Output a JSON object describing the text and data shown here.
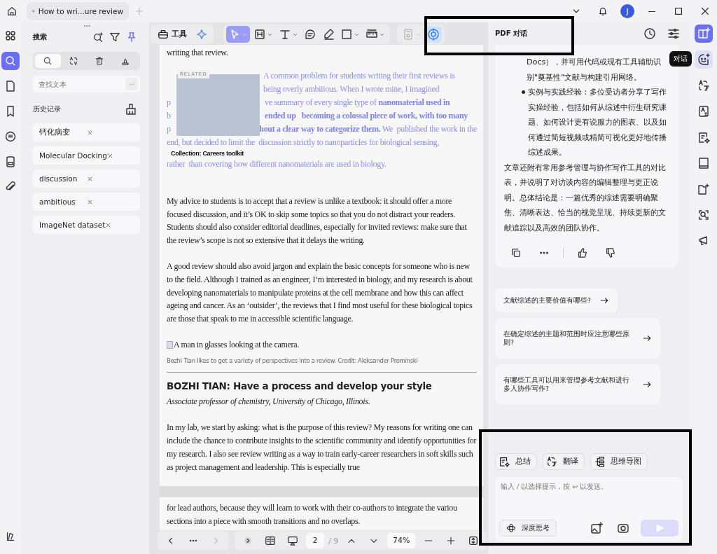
{
  "tab_bar": {
    "tab": "How to wri...ure review",
    "avatar": "J"
  },
  "left_rail": {
    "items": [
      {
        "kind": "apps",
        "selected": false
      },
      {
        "kind": "search",
        "selected": true
      },
      {
        "kind": "page",
        "selected": false
      },
      {
        "kind": "bookmark",
        "selected": false
      },
      {
        "kind": "comment",
        "selected": false
      },
      {
        "kind": "form",
        "selected": false
      },
      {
        "kind": "attachment",
        "selected": false
      }
    ]
  },
  "search_panel": {
    "title": "搜索",
    "modes": [
      {
        "kind": "search",
        "selected": true
      },
      {
        "kind": "replace",
        "selected": false
      },
      {
        "kind": "delete",
        "selected": false
      },
      {
        "kind": "stamp",
        "selected": false
      }
    ],
    "search": {
      "placeholder": "查找文本"
    },
    "history_title": "历史记录",
    "history": [
      "钙化病变",
      "Molecular Docking",
      "discussion",
      "ambitious",
      "ImageNet dataset"
    ]
  },
  "toolbar": {
    "tools_label": "工具",
    "tools": [
      {
        "kind": "select",
        "selected": true,
        "dropdown": true,
        "disabled": false
      },
      {
        "kind": "heading",
        "selected": false,
        "dropdown": true,
        "disabled": false
      },
      {
        "kind": "text",
        "selected": false,
        "dropdown": true,
        "disabled": false
      },
      {
        "kind": "comment",
        "selected": false,
        "dropdown": false,
        "disabled": false
      },
      {
        "kind": "pen",
        "selected": false,
        "dropdown": false,
        "disabled": false
      },
      {
        "kind": "rectangle",
        "selected": false,
        "dropdown": true,
        "disabled": false
      },
      {
        "kind": "measure",
        "selected": false,
        "dropdown": true,
        "disabled": false
      },
      {
        "kind": "save",
        "selected": false,
        "dropdown": true,
        "disabled": true
      },
      {
        "kind": "ai",
        "selected": true,
        "dropdown": false,
        "disabled": false
      }
    ]
  },
  "document": {
    "lead": "writing that review.",
    "related": {
      "label": "RELATED",
      "caption": "Collection: Careers toolkit",
      "lines": [
        {
          "text": "A common problem for students writing their first reviews is"
        },
        {
          "text": "being overly ambitious. When I wrote mine, I imagined"
        },
        {
          "lead": "p",
          "text": "ve summary of every single type of **nanomaterial used in**"
        },
        {
          "lead": "b",
          "text": "**ended up   becoming a colossal piece of work, with too many**"
        },
        {
          "lead": "p",
          "text": "**hout a clear way to categorize them.** We  published the work in the"
        },
        {
          "text": "end, but decided to limit the  discussion strictly to nanoparticles for biological sensing,"
        },
        {
          "text": "rather  than covering how different nanomaterials are used in biology."
        }
      ]
    },
    "paragraphs": [
      "My advice to students is to accept that a review is unlike a textbook: it should offer a more focused discussion, and it’s OK to skip some topics so that you do not distract your readers. Students should also consider editorial deadlines, especially for invited reviews: make sure that the review’s scope is not so extensive that it delays the writing.",
      "A good review should also avoid jargon and explain the basic concepts for someone who is new to the field. Although I trained as an engineer, I’m interested in biology, and my research is about developing nanomaterials to manipulate proteins at the cell membrane and how this can affect ageing and cancer. As an ‘outsider’, the reviews that I find most useful for these biological topics are those that speak to me in accessible scientific language."
    ],
    "image_alt": "A man in glasses looking at the camera.",
    "figure_caption": "Bozhi Tian likes to get a variety of perspectives into a review.  Credit: Aleksander Prominski",
    "heading": "BOZHI TIAN: Have a process and develop your style",
    "subtitle": "Associate professor of chemistry, University of Chicago, Illinois.",
    "paragraphs2": [
      "In my lab, we start by asking: what is the purpose of this review? My reasons for writing one can include the chance to contribute insights to the scientific community and identify opportunities for my research. I also see review writing as a way to train early-career researchers in soft skills such as project management and leadership. This is especially true"
    ],
    "next_page": [
      "for lead authors, because they will learn to work with their co-authors to integrate the variou",
      "sections into a piece with smooth transitions and no overlaps."
    ]
  },
  "page_nav": {
    "page": "2",
    "total": "/ 9",
    "zoom": "74%"
  },
  "chat": {
    "title": "PDF 对话",
    "message": {
      "continuation": "Docs），并可用代码或现有工具辅助识别\"奠基性\"文献与构建引用网络。",
      "bullets": [
        "实例与实践经验：多位受访者分享了写作实操经验，包括如何从综述中衍生研究课题、如何设计更有说服力的图表、以及如何通过简短视频或精简可视化更好地传播综述成果。"
      ],
      "paragraph": "文章还附有常用参考管理与协作写作工具的对比表，并说明了对访谈内容的编辑整理与更正说明。总体结论是：一篇优秀的综述需要明确聚焦、清晰表达、恰当的视觉呈现、持续更新的文献追踪以及高效的团队协作。"
    },
    "suggestions": [
      "文献综述的主要价值有哪些?",
      "在确定综述的主题和范围时应注意哪些原则?",
      "有哪些工具可以用来管理参考文献和进行多人协作写作?"
    ],
    "chips": [
      {
        "kind": "summary",
        "label": "总结"
      },
      {
        "kind": "translate",
        "label": "翻译"
      },
      {
        "kind": "mindmap",
        "label": "思维导图"
      }
    ],
    "input": {
      "placeholder": "输入 / 以选择提示，按 ↩ 以发送。"
    },
    "deep_think": "深度思考"
  },
  "right_rail": {
    "tooltip": "对话",
    "items": [
      {
        "kind": "reader",
        "selected": false
      },
      {
        "kind": "chat",
        "selected": true
      },
      {
        "kind": "translate",
        "selected": false
      },
      {
        "kind": "translate-page",
        "selected": false
      },
      {
        "kind": "summary",
        "selected": false
      },
      {
        "kind": "book",
        "selected": false
      },
      {
        "kind": "folder",
        "selected": false
      },
      {
        "kind": "scan",
        "selected": false
      },
      {
        "kind": "present",
        "selected": false
      }
    ]
  }
}
